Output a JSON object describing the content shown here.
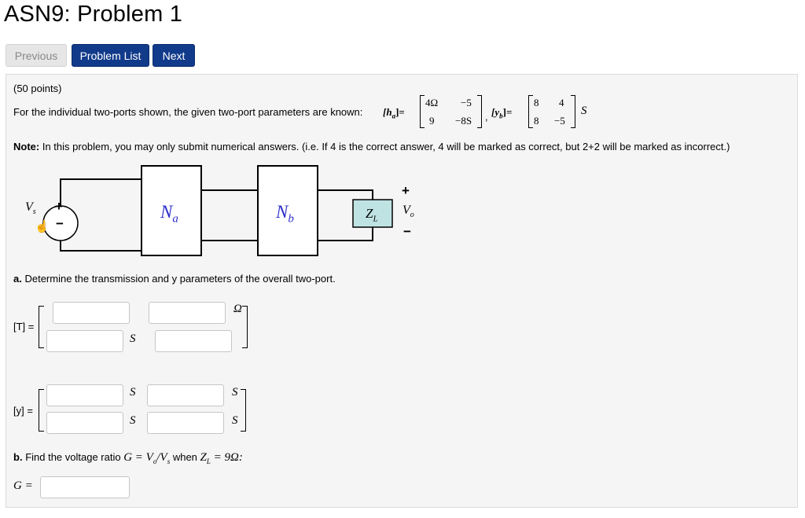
{
  "header": {
    "title": "ASN9: Problem 1"
  },
  "nav": {
    "previous": "Previous",
    "problem_list": "Problem List",
    "next": "Next"
  },
  "problem": {
    "points": "(50 points)",
    "intro": "For the individual two-ports shown, the given two-port parameters are known:",
    "ha_label": "[h",
    "ha_sub": "a",
    "ha_eq": "]=",
    "ha_matrix": {
      "r1c1": "4Ω",
      "r1c2": "−5",
      "r2c1": "9",
      "r2c2": "−8S"
    },
    "comma": ",",
    "yb_label": "[y",
    "yb_sub": "b",
    "yb_eq": "]=",
    "yb_matrix": {
      "r1c1": "8",
      "r1c2": "4",
      "r2c1": "8",
      "r2c2": "−5"
    },
    "yb_unit": "S",
    "note_label": "Note:",
    "note_text": "In this problem, you may only submit numerical answers. (i.e. If 4 is the correct answer, 4 will be marked as correct, but 2+2 will be marked as incorrect.)"
  },
  "circuit": {
    "vs_label": "V",
    "vs_sub": "s",
    "plus": "+",
    "minus": "−",
    "na_label": "N",
    "na_sub": "a",
    "nb_label": "N",
    "nb_sub": "b",
    "zl_label": "Z",
    "zl_sub": "L",
    "vo_label": "V",
    "vo_sub": "o",
    "vo_plus": "+",
    "vo_minus": "−"
  },
  "part_a": {
    "label": "a.",
    "text": "Determine the transmission and y parameters of the overall two-port.",
    "t_label": "[T] =",
    "t_units": {
      "r1c2": "Ω",
      "r2c1": "S"
    },
    "y_label": "[y] =",
    "y_units": {
      "r1c1": "S",
      "r1c2": "S",
      "r2c1": "S",
      "r2c2": "S"
    }
  },
  "part_b": {
    "label": "b.",
    "text_pre": "Find the voltage ratio",
    "formula": "G = V",
    "formula_sub1": "o",
    "formula_mid": "/V",
    "formula_sub2": "s",
    "when": "when",
    "z_label": "Z",
    "z_sub": "L",
    "z_val": "= 9Ω:",
    "g_label": "G ="
  },
  "colors": {
    "nav_active": "#113a8a",
    "network_label": "#2d2dcc",
    "zl_fill": "#bfe3e3",
    "panel_bg": "#f5f5f5"
  }
}
